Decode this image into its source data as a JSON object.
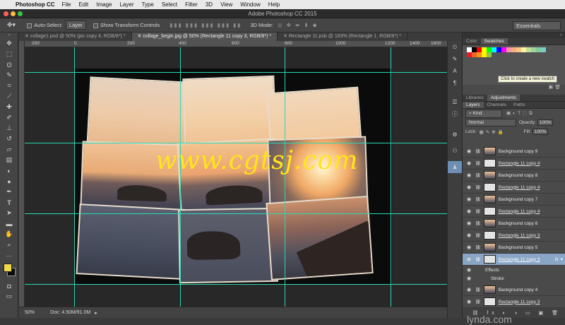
{
  "menubar": {
    "app": "Photoshop CC",
    "items": [
      "File",
      "Edit",
      "Image",
      "Layer",
      "Type",
      "Select",
      "Filter",
      "3D",
      "View",
      "Window",
      "Help"
    ]
  },
  "window_title": "Adobe Photoshop CC 2015",
  "options": {
    "auto_select_label": "Auto-Select:",
    "auto_select_value": "Layer",
    "transform_label": "Show Transform Controls",
    "mode3d_label": "3D Mode:",
    "workspace": "Essentials"
  },
  "tabs": [
    "collage1.psd @ 50% (pic copy 4, RGB/8*) *",
    "collage_begin.jpg @ 50% (Rectangle 11 copy 3, RGB/8*) *",
    "Rectangle 11.psb @ 183% (Rectangle 1, RGB/8*) *"
  ],
  "ruler_labels": [
    "200",
    "0",
    "200",
    "400",
    "600",
    "800",
    "1000",
    "1200",
    "1400",
    "1600",
    "1700"
  ],
  "watermark": "www.cgtsj.com",
  "status": {
    "zoom": "50%",
    "doc": "Doc: 4.50M/91.0M"
  },
  "color_panel": {
    "tabs": [
      "Color",
      "Swatches"
    ],
    "tooltip": "Click to create a new swatch"
  },
  "lib_panel": {
    "tabs": [
      "Libraries",
      "Adjustments"
    ]
  },
  "layers_panel": {
    "tabs": [
      "Layers",
      "Channels",
      "Paths"
    ],
    "kind": "Kind",
    "blend": "Normal",
    "opacity_label": "Opacity:",
    "opacity": "100%",
    "lock_label": "Lock:",
    "fill_label": "Fill:",
    "fill": "100%",
    "layers": [
      {
        "name": "Background copy 9"
      },
      {
        "name": "Rectangle 11 copy 4"
      },
      {
        "name": "Background copy 8"
      },
      {
        "name": "Rectangle 11 copy 4"
      },
      {
        "name": "Background copy 7"
      },
      {
        "name": "Rectangle 11 copy 4"
      },
      {
        "name": "Background copy 6"
      },
      {
        "name": "Rectangle 11 copy 3"
      },
      {
        "name": "Background copy 5"
      },
      {
        "name": "Rectangle 11 copy 3"
      }
    ],
    "effects_label": "Effects",
    "stroke_label": "Stroke",
    "after_layers": [
      {
        "name": "Background copy 4"
      },
      {
        "name": "Rectangle 11 copy 3"
      }
    ],
    "fx_label": "fx"
  },
  "brand": "lynda.com",
  "colors": {
    "accent_guide": "#29d9b3",
    "selected_layer": "#8aa6c6",
    "watermark": "#ffe51a"
  }
}
